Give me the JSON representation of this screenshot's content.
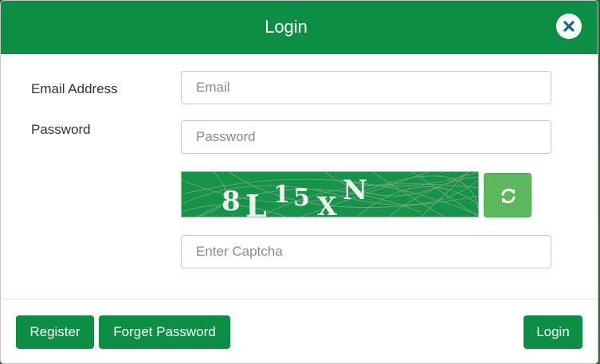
{
  "modal": {
    "title": "Login",
    "close_icon": "close-icon"
  },
  "form": {
    "email_label": "Email Address",
    "email_placeholder": "Email",
    "email_value": "",
    "password_label": "Password",
    "password_placeholder": "Password",
    "password_value": "",
    "captcha_text": [
      "8",
      "L",
      "1",
      "5",
      "X",
      "N"
    ],
    "captcha_placeholder": "Enter Captcha",
    "captcha_value": "",
    "refresh_icon": "refresh-icon"
  },
  "footer": {
    "register_label": "Register",
    "forget_label": "Forget Password",
    "login_label": "Login"
  },
  "colors": {
    "brand_green": "#0c8e45",
    "refresh_green": "#5cb85c",
    "captcha_bg": "#159447"
  }
}
